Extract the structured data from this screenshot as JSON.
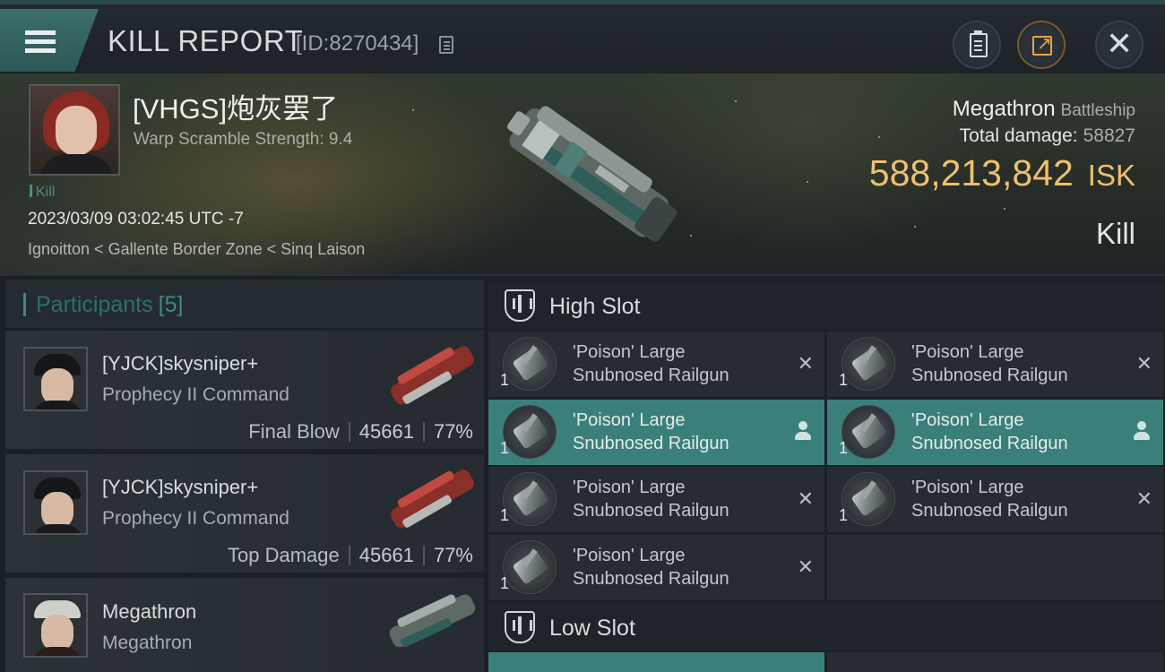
{
  "header": {
    "title": "KILL REPORT",
    "report_id": "[ID:8270434]"
  },
  "victim": {
    "name": "[VHGS]炮灰罢了",
    "warp_scramble": "Warp Scramble Strength: 9.4",
    "tag": "Kill",
    "datetime": "2023/03/09 03:02:45 UTC -7",
    "location": "Ignoitton < Gallente Border Zone < Sinq Laison",
    "ship_name": "Megathron",
    "ship_class": "Battleship",
    "total_damage_label": "Total damage:",
    "total_damage": "58827",
    "isk_value": "588,213,842",
    "isk_unit": "ISK",
    "result": "Kill"
  },
  "participants": {
    "label": "Participants",
    "count": "[5]",
    "items": [
      {
        "name": "[YJCK]skysniper+",
        "ship": "Prophecy II Command",
        "role": "Final Blow",
        "damage": "45661",
        "percent": "77%"
      },
      {
        "name": "[YJCK]skysniper+",
        "ship": "Prophecy II Command",
        "role": "Top Damage",
        "damage": "45661",
        "percent": "77%"
      },
      {
        "name": "Megathron",
        "ship": "Megathron"
      }
    ]
  },
  "slots": {
    "high_label": "High Slot",
    "low_label": "Low Slot",
    "high": [
      {
        "line1": "'Poison' Large",
        "line2": "Snubnosed Railgun",
        "qty": "1",
        "state": "destroyed"
      },
      {
        "line1": "'Poison' Large",
        "line2": "Snubnosed Railgun",
        "qty": "1",
        "state": "destroyed"
      },
      {
        "line1": "'Poison' Large",
        "line2": "Snubnosed Railgun",
        "qty": "1",
        "state": "dropped"
      },
      {
        "line1": "'Poison' Large",
        "line2": "Snubnosed Railgun",
        "qty": "1",
        "state": "dropped"
      },
      {
        "line1": "'Poison' Large",
        "line2": "Snubnosed Railgun",
        "qty": "1",
        "state": "destroyed"
      },
      {
        "line1": "'Poison' Large",
        "line2": "Snubnosed Railgun",
        "qty": "1",
        "state": "destroyed"
      },
      {
        "line1": "'Poison' Large",
        "line2": "Snubnosed Railgun",
        "qty": "1",
        "state": "destroyed"
      }
    ]
  },
  "colors": {
    "accent_teal": "#3b7f7a",
    "isk_gold": "#f0bf6e",
    "share_orange": "#e9a348"
  },
  "icons": {
    "menu": "hamburger-icon",
    "copy": "copy-icon",
    "clipboard": "clipboard-icon",
    "share": "share-icon",
    "close": "close-icon",
    "slot": "slot-icon",
    "destroyed": "x-icon",
    "dropped": "pilot-icon"
  }
}
